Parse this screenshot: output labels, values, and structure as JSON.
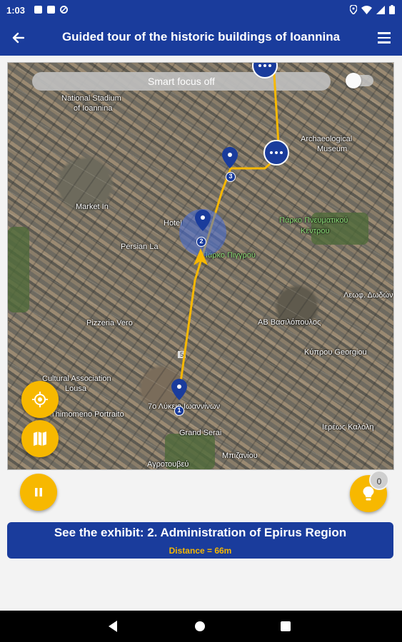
{
  "status_bar": {
    "time": "1:03"
  },
  "app_bar": {
    "title": "Guided tour of the historic buildings of Ioannina"
  },
  "map": {
    "smart_focus_label": "Smart focus off",
    "labels": {
      "national_stadium": "National Stadium",
      "of_ioannina": "of Ioannina",
      "archaeological": "Archaeological",
      "museum": "Museum",
      "market_in": "Market In",
      "hotel": "Hotel",
      "persian_la": "Persian La",
      "pargko_green": "Πάρκο Πιγγρού",
      "pizzeria_vero": "Pizzeria Vero",
      "ab_vasilopoulos": "AB Βασιλόπουλος",
      "kyprou_georgiou": "Κύπρου Georgiou",
      "cultural_association": "Cultural Association",
      "lousa": "Lousa",
      "thimomeno_portraito": "Thimomeno Portraito",
      "grand_serai": "Grand Serai",
      "lykeio": "7ο Λύκειο Ιωαννίνων",
      "parko_kentro": "Πάρκο Πνευματικού",
      "kentrou": "Κέντρου",
      "tetragono": "Αγροτουβεύ",
      "odos": "Μπιζανίου",
      "kaisari": "Καισαρη",
      "tetritou": "Ιερέως Καλόλη",
      "leoforos": "Λεωφ. Δωδώνης",
      "route_marker": "5"
    },
    "stops": [
      "1",
      "2",
      "3"
    ],
    "route_color": "#f7b800"
  },
  "hint_badge_count": "0",
  "exhibit": {
    "title": "See the exhibit: 2. Administration of Epirus Region",
    "distance": "Distance = 66m"
  },
  "colors": {
    "primary": "#1a3c9c",
    "accent": "#f7b800"
  },
  "icons": {
    "back": "arrow-left-icon",
    "menu": "hamburger-menu-icon",
    "locate": "my-location-icon",
    "map_layers": "map-layers-icon",
    "pause": "pause-icon",
    "hint": "lightbulb-icon"
  }
}
